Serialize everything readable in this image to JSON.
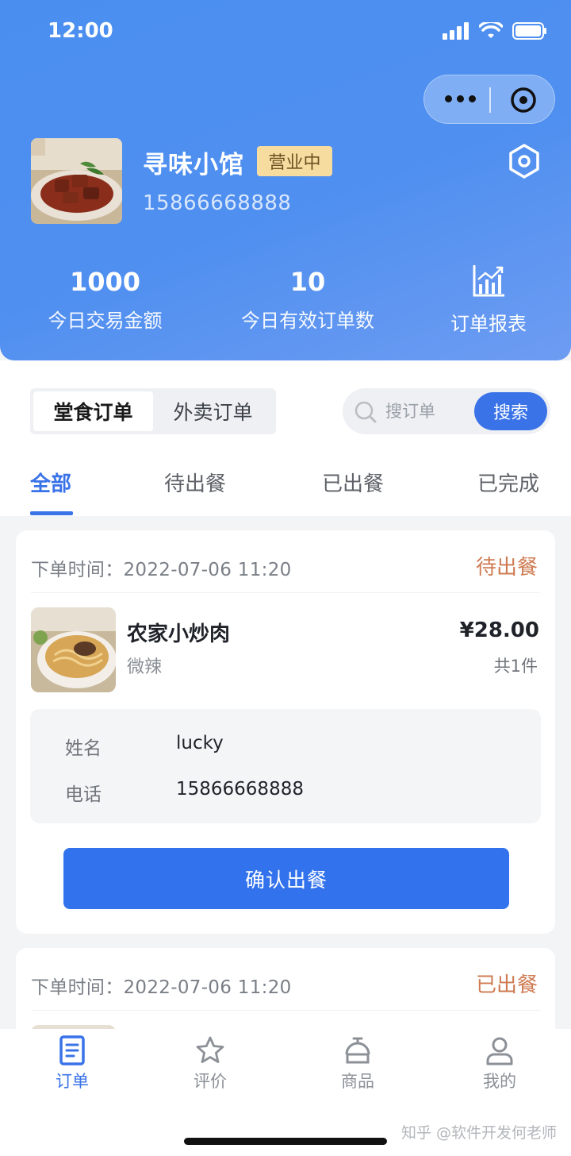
{
  "status_bar": {
    "time": "12:00"
  },
  "shop": {
    "name": "寻味小馆",
    "status_badge": "营业中",
    "phone": "15866668888"
  },
  "stats": [
    {
      "value": "1000",
      "label": "今日交易金额"
    },
    {
      "value": "10",
      "label": "今日有效订单数"
    }
  ],
  "report": {
    "label": "订单报表"
  },
  "order_type": {
    "options": [
      "堂食订单",
      "外卖订单"
    ],
    "selected": "堂食订单"
  },
  "search": {
    "placeholder": "搜订单",
    "button": "搜索"
  },
  "tabs": [
    {
      "label": "全部",
      "active": true
    },
    {
      "label": "待出餐"
    },
    {
      "label": "已出餐"
    },
    {
      "label": "已完成"
    }
  ],
  "orders": [
    {
      "time_label": "下单时间：2022-07-06 11:20",
      "status": "待出餐",
      "dish": {
        "name": "农家小炒肉",
        "spec": "微辣",
        "price": "¥28.00",
        "quantity": "共1件"
      },
      "customer": {
        "name_label": "姓名",
        "name": "lucky",
        "phone_label": "电话",
        "phone": "15866668888"
      },
      "action": "确认出餐"
    },
    {
      "time_label": "下单时间：2022-07-06 11:20",
      "status": "已出餐"
    }
  ],
  "bottom_nav": [
    {
      "label": "订单",
      "icon": "document-icon",
      "active": true
    },
    {
      "label": "评价",
      "icon": "star-icon"
    },
    {
      "label": "商品",
      "icon": "dish-cover-icon"
    },
    {
      "label": "我的",
      "icon": "user-icon"
    }
  ],
  "watermark": "知乎 @软件开发何老师",
  "colors": {
    "primary": "#3a73e8",
    "header_gradient": "#4a8ff0",
    "status_pending": "#cf7b52",
    "badge_bg": "#f7dca0"
  }
}
